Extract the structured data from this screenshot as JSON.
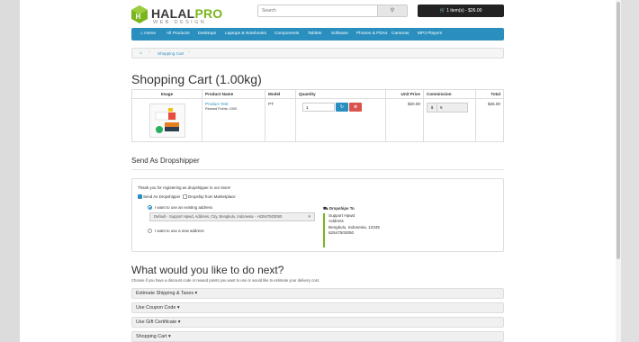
{
  "brand": {
    "name_part1": "HALAL",
    "name_part2": "PRO",
    "tagline": "WEB DESIGN"
  },
  "search": {
    "placeholder": "Search",
    "icon": "search-icon"
  },
  "cart_button": {
    "label": "1 item(s) - $26.00",
    "icon": "cart-icon"
  },
  "nav": {
    "items": [
      "Home",
      "All Products",
      "Desktops",
      "Laptops & Notebooks",
      "Components",
      "Tablets",
      "Software",
      "Phones & PDAs",
      "Cameras",
      "MP3 Players"
    ]
  },
  "breadcrumb": {
    "home_icon": "home-icon",
    "current": "Shopping Cart"
  },
  "page_title": "Shopping Cart  (1.00kg)",
  "cart_table": {
    "headers": {
      "image": "Image",
      "product": "Product Name",
      "model": "Model",
      "quantity": "Quantity",
      "unit_price": "Unit Price",
      "commission": "Commission",
      "total": "Total"
    },
    "row": {
      "product_name": "Product Test",
      "reward": "Reward Points: 1000",
      "model": "PT",
      "quantity": "1",
      "unit_price": "$20.00",
      "commission_currency": "$",
      "commission_value": "6",
      "total": "$26.00"
    }
  },
  "dropshipper": {
    "heading": "Send As Dropshipper",
    "intro": "Thank you for registering as dropshipper in our store!",
    "send_as_label": "Send As Dropshipper",
    "marketplace_label": "Dropship from Marketplace",
    "existing_label": "I want to use an existing address",
    "existing_value": "Default - Support Hpwd, Address, City, Bengkulu, Indonesia - +62547503050",
    "new_label": "I want to use a new address",
    "ship_to_title": "Dropships To",
    "ship_to_lines": [
      "Support Hpwd",
      "Address",
      "Bengkulu, Indonesia, 12345",
      "62547503050"
    ]
  },
  "next_section": {
    "heading": "What would you like to do next?",
    "subtitle": "Choose if you have a discount code or reward points you want to use or would like to estimate your delivery cost.",
    "panels": [
      "Estimate Shipping & Taxes",
      "Use Coupon Code",
      "Use Gift Certificate",
      "Shopping Cart"
    ]
  },
  "colors": {
    "accent": "#2a8fbf",
    "brand_green": "#7ab51d",
    "danger": "#d9534f"
  }
}
